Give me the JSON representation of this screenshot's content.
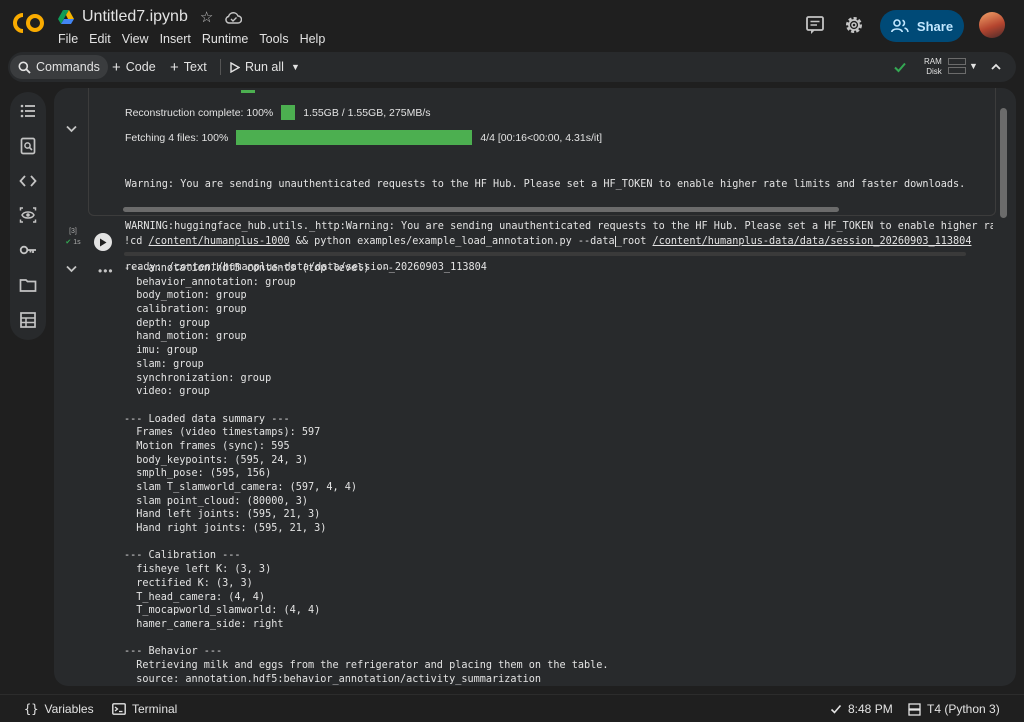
{
  "header": {
    "title": "Untitled7.ipynb",
    "menu": [
      "File",
      "Edit",
      "View",
      "Insert",
      "Runtime",
      "Tools",
      "Help"
    ],
    "share_label": "Share"
  },
  "toolbar": {
    "commands_label": "Commands",
    "code_label": "Code",
    "text_label": "Text",
    "run_all_label": "Run all",
    "ram_label": "RAM",
    "disk_label": "Disk"
  },
  "cell1_output": {
    "reconstruction": {
      "label": "Reconstruction  complete:  100%",
      "progress": 1.0,
      "stats": "1.55GB  /  1.55GB,    275MB/s"
    },
    "fetching": {
      "label": "Fetching  4  files:  100%",
      "progress": 1.0,
      "stats": "4/4  [00:16<00:00,    4.31s/it]"
    },
    "lines": [
      "Warning: You are sending unauthenticated requests to the HF Hub. Please set a HF_TOKEN to enable higher rate limits and faster downloads.",
      "WARNING:huggingface_hub.utils._http:Warning: You are sending unauthenticated requests to the HF Hub. Please set a HF_TOKEN to enable higher rat",
      "ready: /content/humanplus-data/data/session_20260903_113804"
    ]
  },
  "cell2": {
    "exec_count": "[3]",
    "exec_time": "1s",
    "code_prefix": "!cd ",
    "code_path1": "/content/humanplus-1000",
    "code_middle": " && python examples/example_load_annotation.py --data",
    "code_root": "_root",
    "code_space": " ",
    "code_path2": "/content/humanplus-data/data/session_20260903_113804",
    "output": [
      "--- annotation.hdf5 contents (top-level) ---",
      "  behavior_annotation: group",
      "  body_motion: group",
      "  calibration: group",
      "  depth: group",
      "  hand_motion: group",
      "  imu: group",
      "  slam: group",
      "  synchronization: group",
      "  video: group",
      "",
      "--- Loaded data summary ---",
      "  Frames (video timestamps): 597",
      "  Motion frames (sync): 595",
      "  body_keypoints: (595, 24, 3)",
      "  smplh_pose: (595, 156)",
      "  slam T_slamworld_camera: (597, 4, 4)",
      "  slam point_cloud: (80000, 3)",
      "  Hand left joints: (595, 21, 3)",
      "  Hand right joints: (595, 21, 3)",
      "",
      "--- Calibration ---",
      "  fisheye left K: (3, 3)",
      "  rectified K: (3, 3)",
      "  T_head_camera: (4, 4)",
      "  T_mocapworld_slamworld: (4, 4)",
      "  hamer_camera_side: right",
      "",
      "--- Behavior ---",
      "  Retrieving milk and eggs from the refrigerator and placing them on the table.",
      "  source: annotation.hdf5:behavior_annotation/activity_summarization"
    ]
  },
  "statusbar": {
    "variables_label": "Variables",
    "terminal_label": "Terminal",
    "time": "8:48 PM",
    "runtime": "T4 (Python 3)"
  },
  "colors": {
    "accent": "#f9ab00",
    "progress": "#4caf50",
    "share_bg": "#004a77"
  }
}
